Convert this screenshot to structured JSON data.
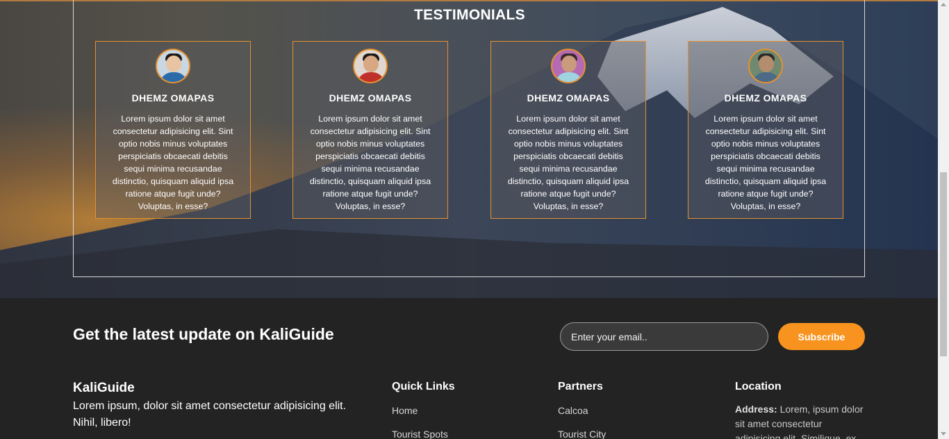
{
  "testimonials": {
    "title": "TESTIMONIALS",
    "cards": [
      {
        "name": "DHEMZ OMAPAS",
        "text": "Lorem ipsum dolor sit amet consectetur adipisicing elit. Sint optio nobis minus voluptates perspiciatis obcaecati debitis sequi minima recusandae distinctio, quisquam aliquid ipsa ratione atque fugit unde? Voluptas, in esse?"
      },
      {
        "name": "DHEMZ OMAPAS",
        "text": "Lorem ipsum dolor sit amet consectetur adipisicing elit. Sint optio nobis minus voluptates perspiciatis obcaecati debitis sequi minima recusandae distinctio, quisquam aliquid ipsa ratione atque fugit unde? Voluptas, in esse?"
      },
      {
        "name": "DHEMZ OMAPAS",
        "text": "Lorem ipsum dolor sit amet consectetur adipisicing elit. Sint optio nobis minus voluptates perspiciatis obcaecati debitis sequi minima recusandae distinctio, quisquam aliquid ipsa ratione atque fugit unde? Voluptas, in esse?"
      },
      {
        "name": "DHEMZ OMAPAS",
        "text": "Lorem ipsum dolor sit amet consectetur adipisicing elit. Sint optio nobis minus voluptates perspiciatis obcaecati debitis sequi minima recusandae distinctio, quisquam aliquid ipsa ratione atque fugit unde? Voluptas, in esse?"
      }
    ]
  },
  "colors": {
    "accent": "#f7931e",
    "card_border": "#e6912d",
    "footer_bg": "#232323"
  },
  "newsletter": {
    "title": "Get the latest update on KaliGuide",
    "email_placeholder": "Enter your email..",
    "subscribe_label": "Subscribe"
  },
  "footer": {
    "brand": {
      "title": "KaliGuide",
      "text": "Lorem ipsum, dolor sit amet consectetur adipisicing elit. Nihil, libero!"
    },
    "quick_links": {
      "title": "Quick Links",
      "items": [
        "Home",
        "Tourist Spots"
      ]
    },
    "partners": {
      "title": "Partners",
      "items": [
        "Calcoa",
        "Tourist City"
      ]
    },
    "location": {
      "title": "Location",
      "address_label": "Address:",
      "address_text": "Lorem, ipsum dolor sit amet consectetur adipisicing elit. Similique, ex"
    }
  }
}
